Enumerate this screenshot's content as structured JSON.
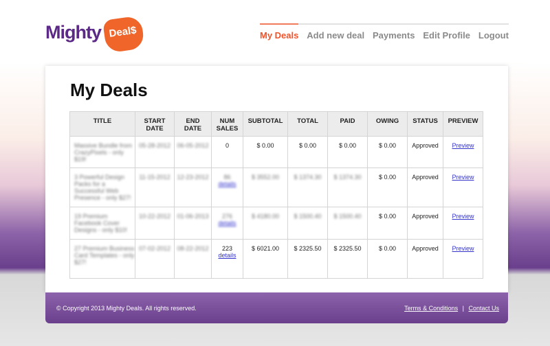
{
  "brand": {
    "word": "Mighty",
    "tag": "Deal$"
  },
  "nav": [
    "My Deals",
    "Add new deal",
    "Payments",
    "Edit Profile",
    "Logout"
  ],
  "page_title": "My Deals",
  "columns": [
    "TITLE",
    "START DATE",
    "END DATE",
    "NUM SALES",
    "SUBTOTAL",
    "TOTAL",
    "PAID",
    "OWING",
    "STATUS",
    "PREVIEW"
  ],
  "rows": [
    {
      "title": "Massive Bundle from CrazyPixels - only $19!",
      "start": "05-28-2012",
      "end": "06-05-2012",
      "sales": "0",
      "details": "",
      "subtotal": "$ 0.00",
      "total": "$ 0.00",
      "paid": "$ 0.00",
      "owing": "$ 0.00",
      "status": "Approved",
      "preview": "Preview",
      "blur": false
    },
    {
      "title": "3 Powerful Design Packs for a Successful Web Presence - only $27!",
      "start": "11-15-2012",
      "end": "12-23-2012",
      "sales": "86",
      "details": "details",
      "subtotal": "$ 3552.00",
      "total": "$ 1374.30",
      "paid": "$ 1374.30",
      "owing": "$ 0.00",
      "status": "Approved",
      "preview": "Preview",
      "blur": true
    },
    {
      "title": "19 Premium Facebook Cover Designs - only $10!",
      "start": "10-22-2012",
      "end": "01-06-2013",
      "sales": "276",
      "details": "details",
      "subtotal": "$ 4180.00",
      "total": "$ 1500.40",
      "paid": "$ 1500.40",
      "owing": "$ 0.00",
      "status": "Approved",
      "preview": "Preview",
      "blur": true
    },
    {
      "title": "27 Premium Business Card Templates - only $27!",
      "start": "07-02-2012",
      "end": "08-22-2012",
      "sales": "223",
      "details": "details",
      "subtotal": "$ 6021.00",
      "total": "$ 2325.50",
      "paid": "$ 2325.50",
      "owing": "$ 0.00",
      "status": "Approved",
      "preview": "Preview",
      "blur": false
    }
  ],
  "footer": {
    "copyright": "© Copyright 2013 Mighty Deals. All rights reserved.",
    "terms": "Terms & Conditions",
    "sep": "|",
    "contact": "Contact Us"
  }
}
